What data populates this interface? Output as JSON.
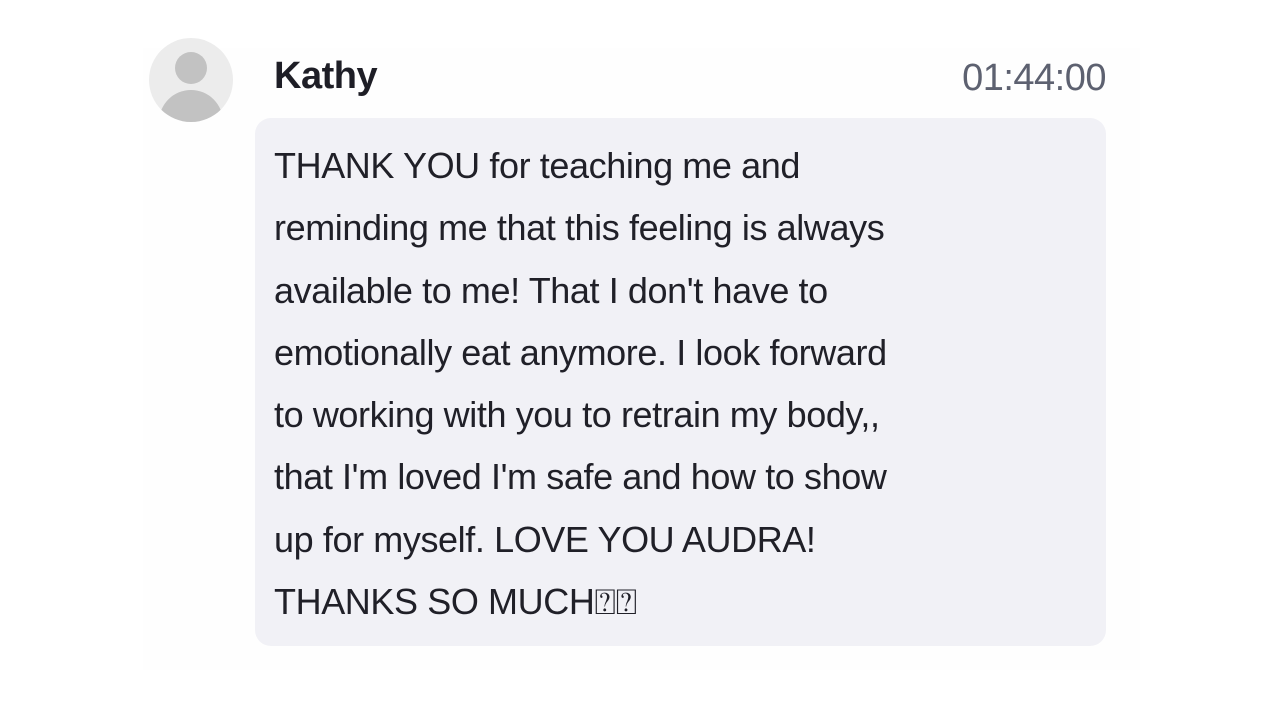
{
  "message": {
    "sender": "Kathy",
    "timestamp": "01:44:00",
    "lines": [
      "THANK YOU for teaching me and",
      "reminding me that this feeling is always",
      "available to me! That I don't have to",
      "emotionally eat anymore. I look forward",
      "to working with you to retrain my body,,",
      "that I'm loved I'm safe and how to show",
      "up for myself. LOVE YOU AUDRA!",
      "THANKS SO MUCH⍰⍰"
    ]
  },
  "avatar": {
    "icon": "user-avatar-placeholder-icon"
  },
  "colors": {
    "bubble_background": "#f1f1f6",
    "sender_text": "#1e1e26",
    "timestamp_text": "#5d6170",
    "avatar_background": "#ececec",
    "avatar_figure": "#c2c2c2"
  }
}
